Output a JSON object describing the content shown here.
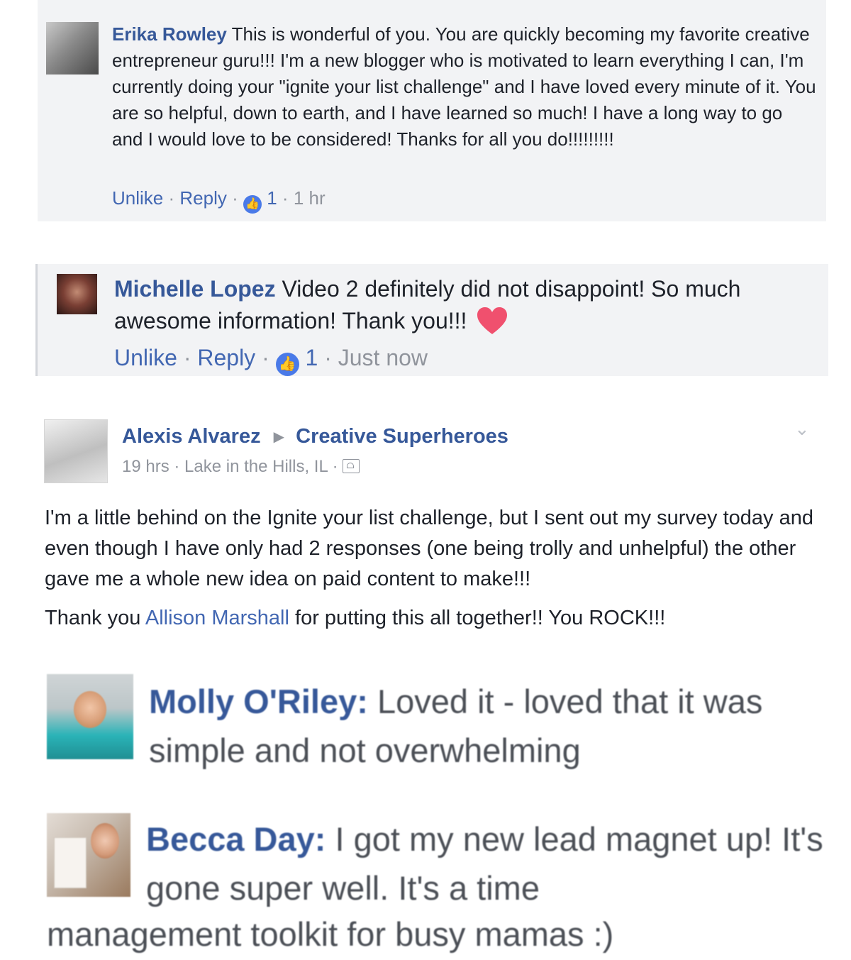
{
  "comments": [
    {
      "author": "Erika Rowley",
      "text": "This is wonderful of you. You are quickly becoming my favorite creative entrepreneur guru!!! I'm a new blogger who is motivated to learn everything I can, I'm currently doing your \"ignite your list challenge\" and I have loved every minute of it. You are so helpful, down to earth, and I have learned so much! I have a long way to go and I would love to be considered! Thanks for all you do!!!!!!!!!",
      "actions": {
        "unlike": "Unlike",
        "reply": "Reply",
        "like_count": "1",
        "time": "1 hr"
      }
    },
    {
      "author": "Michelle Lopez",
      "text": "Video 2 definitely did not disappoint! So much awesome information! Thank you!!!",
      "emoji": "❤",
      "actions": {
        "unlike": "Unlike",
        "reply": "Reply",
        "like_count": "1",
        "time": "Just now"
      }
    }
  ],
  "post": {
    "author": "Alexis Alvarez",
    "group": "Creative Superheroes",
    "time": "19 hrs",
    "location": "Lake in the Hills, IL",
    "paragraph1": "I'm a little behind on the Ignite your list challenge, but I sent out my survey today and even though I have only had 2 responses (one being trolly and unhelpful) the other gave me a whole new idea on paid content to make!!!",
    "paragraph2_prefix": "Thank you ",
    "mention": "Allison Marshall",
    "paragraph2_suffix": " for putting this all together!! You ROCK!!!"
  },
  "testimonials": [
    {
      "name": "Molly O'Riley:",
      "text": "Loved it - loved that it was simple and not overwhelming"
    },
    {
      "name": "Becca Day:",
      "text_line1": "I got my new lead magnet up! It's gone super well. It's a time",
      "text_line2": "management toolkit for busy mamas :)"
    }
  ],
  "icons": {
    "like_badge": "thumbs-up-icon",
    "heart": "heart-icon",
    "audience": "audience-icon",
    "arrow": "triangle-right-icon",
    "chevron": "chevron-down-icon"
  },
  "colors": {
    "name": "#365899",
    "link": "#4267b2",
    "meta": "#90949c",
    "comment_bg": "#f2f3f5",
    "like_blue": "#4a7ae8",
    "heart": "#f0506e"
  }
}
